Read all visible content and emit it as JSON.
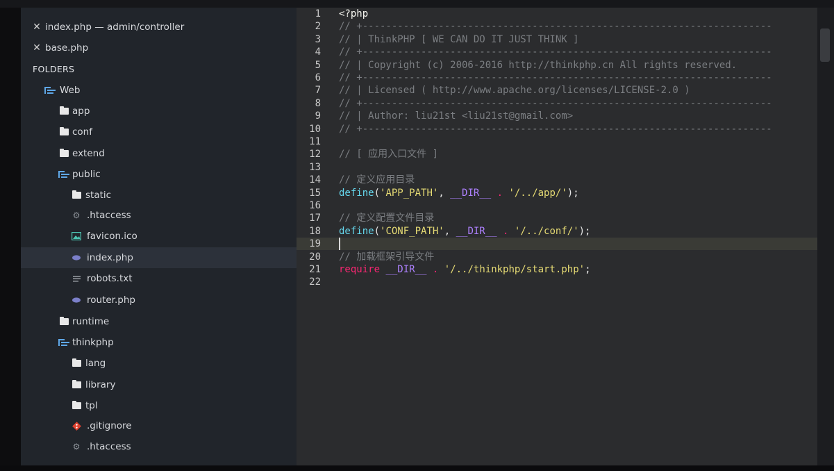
{
  "open_files": [
    {
      "label": "index.php — admin/controller",
      "close_icon": "close-icon"
    },
    {
      "label": "base.php",
      "close_icon": "close-icon"
    }
  ],
  "folders_header": "FOLDERS",
  "tree": [
    {
      "label": "Web",
      "icon": "open-folder-icon"
    },
    {
      "label": "app",
      "icon": "folder-icon"
    },
    {
      "label": "conf",
      "icon": "folder-icon"
    },
    {
      "label": "extend",
      "icon": "folder-icon"
    },
    {
      "label": "public",
      "icon": "open-folder-icon"
    },
    {
      "label": "static",
      "icon": "folder-icon"
    },
    {
      "label": ".htaccess",
      "icon": "gear-file-icon"
    },
    {
      "label": "favicon.ico",
      "icon": "image-file-icon"
    },
    {
      "label": "index.php",
      "icon": "php-file-icon",
      "selected": true
    },
    {
      "label": "robots.txt",
      "icon": "text-file-icon"
    },
    {
      "label": "router.php",
      "icon": "php-file-icon"
    },
    {
      "label": "runtime",
      "icon": "folder-icon"
    },
    {
      "label": "thinkphp",
      "icon": "open-folder-icon"
    },
    {
      "label": "lang",
      "icon": "folder-icon"
    },
    {
      "label": "library",
      "icon": "folder-icon"
    },
    {
      "label": "tpl",
      "icon": "folder-icon"
    },
    {
      "label": ".gitignore",
      "icon": "git-file-icon"
    },
    {
      "label": ".htaccess",
      "icon": "gear-file-icon"
    }
  ],
  "editor": {
    "current_line": 19,
    "lines": [
      [
        {
          "t": "<?php",
          "c": "tag"
        }
      ],
      [
        {
          "t": "// +----------------------------------------------------------------------",
          "c": "comment"
        }
      ],
      [
        {
          "t": "// | ThinkPHP [ WE CAN DO IT JUST THINK ]",
          "c": "comment"
        }
      ],
      [
        {
          "t": "// +----------------------------------------------------------------------",
          "c": "comment"
        }
      ],
      [
        {
          "t": "// | Copyright (c) 2006-2016 http://thinkphp.cn All rights reserved.",
          "c": "comment"
        }
      ],
      [
        {
          "t": "// +----------------------------------------------------------------------",
          "c": "comment"
        }
      ],
      [
        {
          "t": "// | Licensed ( http://www.apache.org/licenses/LICENSE-2.0 )",
          "c": "comment"
        }
      ],
      [
        {
          "t": "// +----------------------------------------------------------------------",
          "c": "comment"
        }
      ],
      [
        {
          "t": "// | Author: liu21st <liu21st@gmail.com>",
          "c": "comment"
        }
      ],
      [
        {
          "t": "// +----------------------------------------------------------------------",
          "c": "comment"
        }
      ],
      [],
      [
        {
          "t": "// [ 应用入口文件 ]",
          "c": "comment"
        }
      ],
      [],
      [
        {
          "t": "// 定义应用目录",
          "c": "comment"
        }
      ],
      [
        {
          "t": "define",
          "c": "fn"
        },
        {
          "t": "(",
          "c": "punc"
        },
        {
          "t": "'APP_PATH'",
          "c": "str"
        },
        {
          "t": ", ",
          "c": "punc"
        },
        {
          "t": "__DIR__",
          "c": "const"
        },
        {
          "t": " . ",
          "c": "op"
        },
        {
          "t": "'/../app/'",
          "c": "str"
        },
        {
          "t": ");",
          "c": "punc"
        }
      ],
      [],
      [
        {
          "t": "// 定义配置文件目录",
          "c": "comment"
        }
      ],
      [
        {
          "t": "define",
          "c": "fn"
        },
        {
          "t": "(",
          "c": "punc"
        },
        {
          "t": "'CONF_PATH'",
          "c": "str"
        },
        {
          "t": ", ",
          "c": "punc"
        },
        {
          "t": "__DIR__",
          "c": "const"
        },
        {
          "t": " . ",
          "c": "op"
        },
        {
          "t": "'/../conf/'",
          "c": "str"
        },
        {
          "t": ");",
          "c": "punc"
        }
      ],
      [],
      [
        {
          "t": "// 加载框架引导文件",
          "c": "comment"
        }
      ],
      [
        {
          "t": "require",
          "c": "kw"
        },
        {
          "t": " ",
          "c": "punc"
        },
        {
          "t": "__DIR__",
          "c": "const"
        },
        {
          "t": " . ",
          "c": "op"
        },
        {
          "t": "'/../thinkphp/start.php'",
          "c": "str"
        },
        {
          "t": ";",
          "c": "punc"
        }
      ],
      []
    ]
  }
}
